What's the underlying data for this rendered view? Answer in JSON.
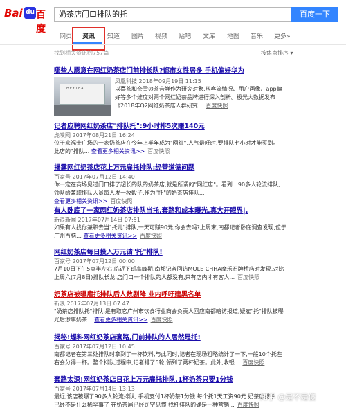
{
  "header": {
    "logo_text": "百度",
    "query": "奶茶店门口排队的托",
    "search_button": "百度一下"
  },
  "tabs": [
    "网页",
    "资讯",
    "知道",
    "图片",
    "视频",
    "贴吧",
    "文库",
    "地图",
    "音乐",
    "更多»"
  ],
  "active_tab": "资讯",
  "result_count": "找到相关资讯约757篇",
  "sort_label": "按焦点排序 ▾",
  "results": [
    {
      "title": "哪些人愿意在网红奶茶店门前排长队?都市女性居多 手机偏好华为",
      "meta": "凤凰科技  2018年09月19日 11:15",
      "abs": [
        "以喜茶和奈雪の茶音鲜作为研究对象,从客流情况、用户画像、app偏",
        "好等多个维度对两个网红奶茶品牌进行深入剖析。极光大数据发布",
        "《2018年Q2网红奶茶店人群研究..."
      ],
      "snapshot": "百度快照"
    },
    {
      "title": "记者应聘网红奶茶店\"排队托\":9小时排5次赚140元",
      "meta": "虎嗅网  2017年08月21日 16:24",
      "abs": [
        "位于来福士广场的一家奶茶店在今年上半年成为\"网红\",人气最旺时,要排队七小时才能买到。",
        "此店的\"排队..."
      ],
      "more": "查看更多相关资讯>>",
      "snapshot": "百度快照"
    },
    {
      "title": "揭露网红奶茶店花上万元雇托排队:经营道德问题",
      "meta": "百家号  2017年07月12日 14:40",
      "abs": [
        "你一定在商场见过门口排了超长的队的奶茶店,就是所谓的\"网红店\"。看到…90多人轮流排队,",
        "领队给兼职排队人员每人发一枚骰子,作为\"托\"的奶茶店排队..."
      ],
      "more": "查看更多相关资讯>>",
      "snapshot": "百度快照"
    },
    {
      "title": "有人卧底了一家网红奶茶店排队当托,套路和成本曝光,真大开眼界|...",
      "meta": "新浪新闻  2017年07月14日 07:51",
      "abs": [
        "如果有人找你兼职去当\"托儿\"排队,一天可赚90元,你会去吗?上周末,南都记者卧底调查发现,位于",
        "广州百脑…"
      ],
      "more": "查看更多相关资讯>>",
      "snapshot": "百度快照"
    },
    {
      "title": "网红奶茶店每日投入万元请\"托\"排队!",
      "meta": "百家号  2017年07月12日 00:00",
      "abs": [
        "7月10日下午5点半左右,临近下班高峰期,南都记者回访MOLE CHHA摩乐石牌桥店时发现,对比",
        "上周六(7月8日)排队长龙,店门口一个排队的人都没有,只有店内才有客人..."
      ],
      "snapshot": "百度快照"
    },
    {
      "title": "奶茶店被曝雇托排队后人数剧降 业内呼吁建黑名单",
      "meta": "新浪  2017年07月13日 07:47",
      "abs": [
        "\"奶茶店排队托\"排队,是有取它广州市饮食行业商会负责人回应南都暗访报道,疑雇\"托\"排队被曝",
        "光后涉事奶茶..."
      ],
      "more": "查看更多相关资讯>>",
      "snapshot": "百度快照"
    },
    {
      "title": "揭秘!爆料网红奶茶店套路,门前排队的人居然是托!",
      "meta": "百家号  2017年07月12日 10:45",
      "abs": [
        "南都记者在第三处排队时拿到了一杯饮料,与此同时,记者在现场粗略统计了一下,一般10个托左",
        "右会分得一杯。整个排队过程中,记者排了5轮,领到了两杯奶茶。此外,收银..."
      ],
      "snapshot": "百度快照"
    },
    {
      "title": "套路太深!网红奶茶店日花上万元雇托排队,1杯奶茶只要1分钱",
      "meta": "百家号  2017年07月14日 13:13",
      "abs": [
        "最近,该店被曝了90多人轮流排队, 手机支付1杯奶茶1分钱 每个托1天工资90元 奶茶店排队",
        "已经不是什么稀罕事了 在奶茶届已经司空见惯 找托排队的确是一种营销..."
      ],
      "snapshot": "百度快照"
    }
  ],
  "watermark": "知乎 @是不是傻"
}
